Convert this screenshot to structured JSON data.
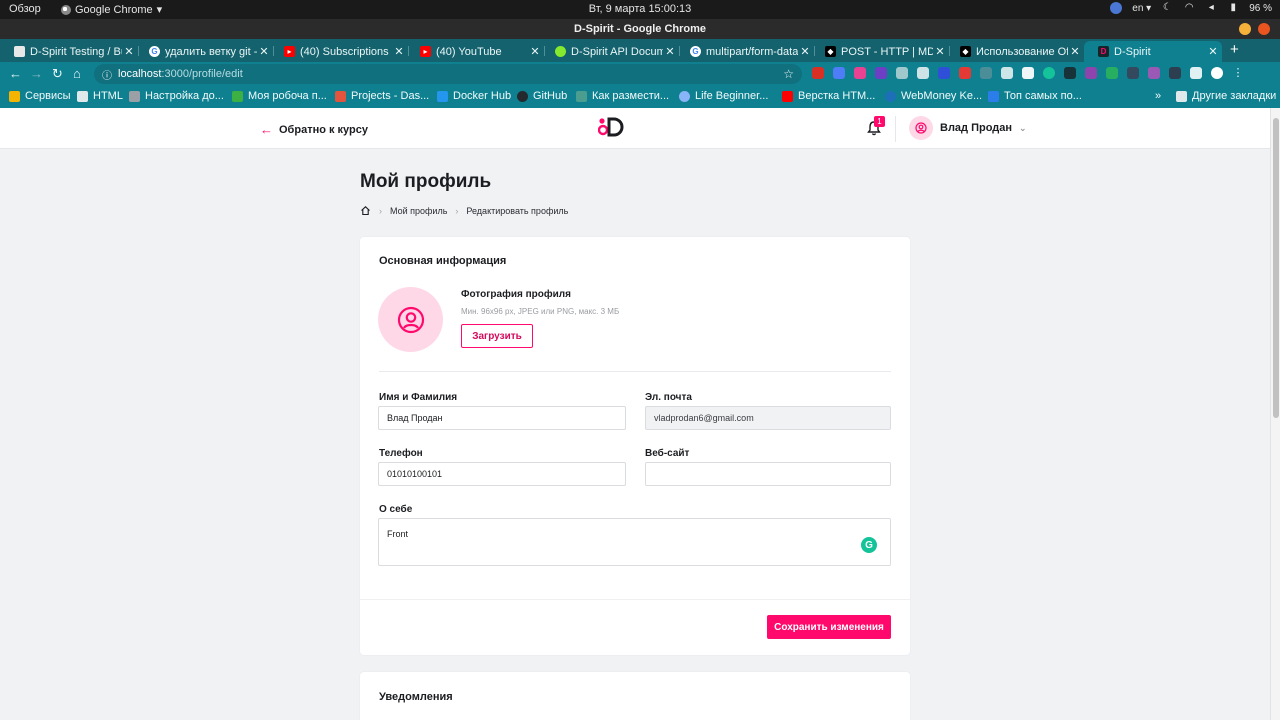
{
  "os_bar": {
    "overview": "Обзор",
    "app_name": "Google Chrome",
    "clock": "Вт, 9 марта  15:00:13",
    "lang": "en",
    "battery": "96 %"
  },
  "window": {
    "title": "D-Spirit - Google Chrome"
  },
  "tabs": [
    {
      "title": "D-Spirit Testing / Bu",
      "icon": "trello-icon",
      "color": "#e8e8e8"
    },
    {
      "title": "удалить ветку git - Г",
      "icon": "google-icon",
      "color": "#ffffff"
    },
    {
      "title": "(40) Subscriptions - ",
      "icon": "youtube-icon",
      "color": "#ff0000"
    },
    {
      "title": "(40) YouTube",
      "icon": "youtube-icon",
      "color": "#ff0000"
    },
    {
      "title": "D-Spirit API Docume",
      "icon": "swagger-icon",
      "color": "#85ea2d"
    },
    {
      "title": "multipart/form-data",
      "icon": "google-icon",
      "color": "#ffffff"
    },
    {
      "title": "POST - HTTP | MDN",
      "icon": "mdn-icon",
      "color": "#000000"
    },
    {
      "title": "Использование Of",
      "icon": "mdn-icon",
      "color": "#000000"
    },
    {
      "title": "D-Spirit",
      "icon": "dspirit-icon",
      "color": "#ff0a6c"
    }
  ],
  "address": {
    "host": "localhost",
    "path": ":3000/profile/edit"
  },
  "bookmarks": [
    {
      "label": "Сервисы",
      "color": "#f4b400"
    },
    {
      "label": "HTML",
      "color": "#5f6368"
    },
    {
      "label": "Настройка до...",
      "color": "#9aa0a6"
    },
    {
      "label": "Моя робоча п...",
      "color": "#3cb043"
    },
    {
      "label": "Projects - Das...",
      "color": "#e2543d"
    },
    {
      "label": "Docker Hub",
      "color": "#2496ed"
    },
    {
      "label": "GitHub",
      "color": "#24292e"
    },
    {
      "label": "Как размести...",
      "color": "#4a9d8f"
    },
    {
      "label": "Life Beginner...",
      "color": "#8ab4f8"
    },
    {
      "label": "Верстка HTM...",
      "color": "#ff0000"
    },
    {
      "label": "WebMoney Ke...",
      "color": "#1d6fb8"
    },
    {
      "label": "Топ самых по...",
      "color": "#2b7de9"
    }
  ],
  "bookmarks_more": "»",
  "bookmarks_other": "Другие закладки",
  "header": {
    "back_label": "Обратно к курсу",
    "notifications_count": "1",
    "user_name": "Влад Продан"
  },
  "page": {
    "title": "Мой профиль",
    "breadcrumb": [
      "Мой профиль",
      "Редактировать профиль"
    ]
  },
  "basic_info": {
    "title": "Основная информация",
    "photo_label": "Фотография профиля",
    "photo_hint": "Мин. 96x96 px, JPEG или PNG, макс. 3 МБ",
    "upload_label": "Загрузить",
    "name_label": "Имя и Фамилия",
    "name_value": "Влад Продан",
    "email_label": "Эл. почта",
    "email_value": "vladprodan6@gmail.com",
    "phone_label": "Телефон",
    "phone_value": "01010100101",
    "website_label": "Веб-сайт",
    "website_value": "",
    "about_label": "О себе",
    "about_value": "Front",
    "save_label": "Сохранить изменения"
  },
  "notifications": {
    "title": "Уведомления"
  },
  "colors": {
    "accent": "#ff0a6c",
    "accent_soft": "#ffd8e8",
    "chrome_teal": "#0e8090"
  }
}
